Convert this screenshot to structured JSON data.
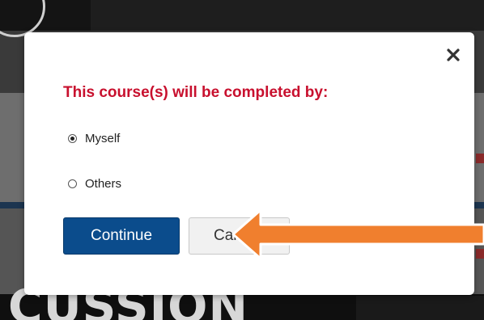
{
  "modal": {
    "title": "This course(s) will be completed by:",
    "options": [
      {
        "label": "Myself",
        "selected": true
      },
      {
        "label": "Others",
        "selected": false
      }
    ],
    "continue_label": "Continue",
    "cancel_label": "Cancel",
    "cancel_visible_text": "Can"
  },
  "background": {
    "bottom_text": "CUSSION"
  },
  "colors": {
    "title": "#c8102e",
    "primary_button": "#0b4c8c",
    "annotation_arrow": "#f07f2e"
  },
  "icons": {
    "close": "close-icon",
    "annotation": "arrow-left-icon"
  }
}
